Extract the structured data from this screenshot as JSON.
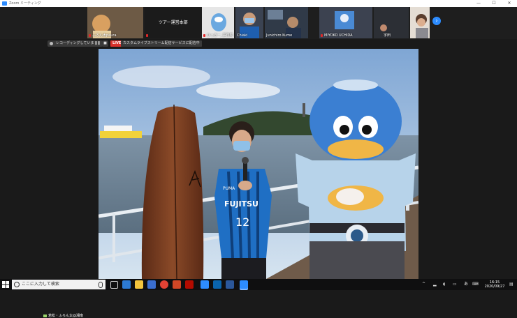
{
  "window": {
    "title": "Zoom ミーティング",
    "minimize_label": "—",
    "maximize_label": "☐",
    "close_label": "✕"
  },
  "participants": [
    {
      "name": "ふろん太paura",
      "muted": true
    },
    {
      "name": "ツアー運営本部",
      "muted": true
    },
    {
      "name": "ひっきー_事務局",
      "muted": true
    },
    {
      "name": "Chiaki",
      "muted": false
    },
    {
      "name": "Junichiro Kume",
      "muted": false
    },
    {
      "name": "MIYOKO UCHIDA",
      "muted": true
    },
    {
      "name": "宇田",
      "muted": true
    },
    {
      "name": "",
      "muted": true
    }
  ],
  "participant_strip": {
    "next_label": "›"
  },
  "recording": {
    "label": "レコーディングしています...",
    "pause_label": "❚❚",
    "stop_label": "■"
  },
  "live": {
    "badge": "LIVE",
    "stream_label": "カスタムライブストリーム配信サービスに配信中"
  },
  "speaker": {
    "label": "若松・ふろん太@湘南"
  },
  "video_scene": {
    "jersey_sponsor": "FUJITSU",
    "jersey_number": "12",
    "jersey_brand": "PUMA"
  },
  "taskbar": {
    "search_placeholder": "ここに入力して検索",
    "ime": "あ",
    "time": "16:15",
    "date": "2020/09/27",
    "apps": [
      "task-view-icon",
      "edge-icon",
      "explorer-icon",
      "store-icon",
      "chrome-icon",
      "powerpoint-icon",
      "acrobat-icon",
      "zoom-icon",
      "outlook-icon",
      "word-icon",
      "zoom-active-icon"
    ]
  },
  "colors": {
    "zoom_blue": "#2d8cff",
    "live_red": "#d9302b",
    "jersey_blue": "#1f6fc4",
    "mascot_blue": "#3b7fd2"
  }
}
